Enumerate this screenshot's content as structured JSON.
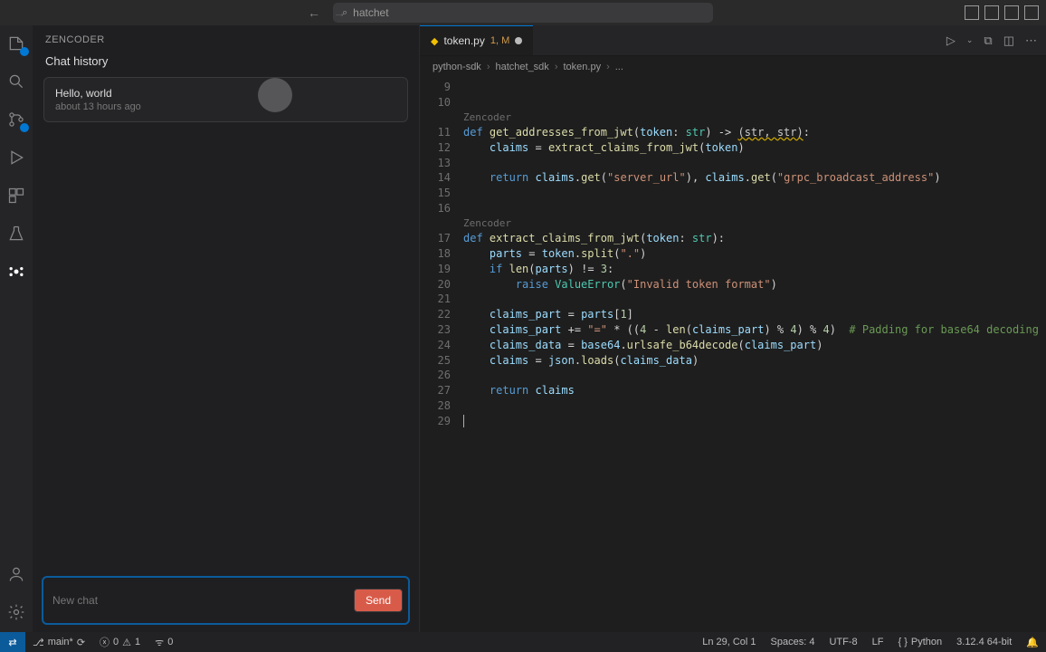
{
  "titlebar": {
    "search": "hatchet"
  },
  "sidebar": {
    "brand": "ZENCODER",
    "history_header": "Chat history",
    "items": [
      {
        "title": "Hello, world",
        "time": "about 13 hours ago"
      }
    ],
    "newchat_placeholder": "New chat",
    "send_label": "Send"
  },
  "tabs": {
    "file": "token.py",
    "problems": "1, M"
  },
  "breadcrumb": {
    "segments": [
      "python-sdk",
      "hatchet_sdk",
      "token.py",
      "..."
    ]
  },
  "codelens": "Zencoder",
  "code_lines": [
    {
      "n": 9,
      "seg": []
    },
    {
      "n": 10,
      "seg": []
    },
    {
      "lens": true
    },
    {
      "n": 11,
      "seg": [
        [
          "kw",
          "def "
        ],
        [
          "fn",
          "get_addresses_from_jwt"
        ],
        [
          "op",
          "("
        ],
        [
          "var",
          "token"
        ],
        [
          "op",
          ": "
        ],
        [
          "type",
          "str"
        ],
        [
          "op",
          ") -> "
        ],
        [
          "ret",
          "(str, str)"
        ],
        [
          "op",
          ":"
        ]
      ]
    },
    {
      "n": 12,
      "seg": [
        [
          "op",
          "    "
        ],
        [
          "var",
          "claims"
        ],
        [
          "op",
          " = "
        ],
        [
          "fn",
          "extract_claims_from_jwt"
        ],
        [
          "op",
          "("
        ],
        [
          "var",
          "token"
        ],
        [
          "op",
          ")"
        ]
      ]
    },
    {
      "n": 13,
      "seg": []
    },
    {
      "n": 14,
      "seg": [
        [
          "op",
          "    "
        ],
        [
          "kw",
          "return"
        ],
        [
          "op",
          " "
        ],
        [
          "var",
          "claims"
        ],
        [
          "op",
          "."
        ],
        [
          "fn",
          "get"
        ],
        [
          "op",
          "("
        ],
        [
          "str",
          "\"server_url\""
        ],
        [
          "op",
          "), "
        ],
        [
          "var",
          "claims"
        ],
        [
          "op",
          "."
        ],
        [
          "fn",
          "get"
        ],
        [
          "op",
          "("
        ],
        [
          "str",
          "\"grpc_broadcast_address\""
        ],
        [
          "op",
          ")"
        ]
      ]
    },
    {
      "n": 15,
      "seg": []
    },
    {
      "n": 16,
      "seg": []
    },
    {
      "lens": true
    },
    {
      "n": 17,
      "seg": [
        [
          "kw",
          "def "
        ],
        [
          "fn",
          "extract_claims_from_jwt"
        ],
        [
          "op",
          "("
        ],
        [
          "var",
          "token"
        ],
        [
          "op",
          ": "
        ],
        [
          "type",
          "str"
        ],
        [
          "op",
          "):"
        ]
      ]
    },
    {
      "n": 18,
      "seg": [
        [
          "op",
          "    "
        ],
        [
          "var",
          "parts"
        ],
        [
          "op",
          " = "
        ],
        [
          "var",
          "token"
        ],
        [
          "op",
          "."
        ],
        [
          "fn",
          "split"
        ],
        [
          "op",
          "("
        ],
        [
          "str",
          "\".\""
        ],
        [
          "op",
          ")"
        ]
      ]
    },
    {
      "n": 19,
      "seg": [
        [
          "op",
          "    "
        ],
        [
          "kw",
          "if"
        ],
        [
          "op",
          " "
        ],
        [
          "fn",
          "len"
        ],
        [
          "op",
          "("
        ],
        [
          "var",
          "parts"
        ],
        [
          "op",
          ") != "
        ],
        [
          "num",
          "3"
        ],
        [
          "op",
          ":"
        ]
      ]
    },
    {
      "n": 20,
      "seg": [
        [
          "op",
          "        "
        ],
        [
          "kw",
          "raise"
        ],
        [
          "op",
          " "
        ],
        [
          "type",
          "ValueError"
        ],
        [
          "op",
          "("
        ],
        [
          "str",
          "\"Invalid token format\""
        ],
        [
          "op",
          ")"
        ]
      ]
    },
    {
      "n": 21,
      "seg": []
    },
    {
      "n": 22,
      "seg": [
        [
          "op",
          "    "
        ],
        [
          "var",
          "claims_part"
        ],
        [
          "op",
          " = "
        ],
        [
          "var",
          "parts"
        ],
        [
          "op",
          "["
        ],
        [
          "num",
          "1"
        ],
        [
          "op",
          "]"
        ]
      ]
    },
    {
      "n": 23,
      "seg": [
        [
          "op",
          "    "
        ],
        [
          "var",
          "claims_part"
        ],
        [
          "op",
          " += "
        ],
        [
          "str",
          "\"=\""
        ],
        [
          "op",
          " * (("
        ],
        [
          "num",
          "4"
        ],
        [
          "op",
          " - "
        ],
        [
          "fn",
          "len"
        ],
        [
          "op",
          "("
        ],
        [
          "var",
          "claims_part"
        ],
        [
          "op",
          ") % "
        ],
        [
          "num",
          "4"
        ],
        [
          "op",
          ") % "
        ],
        [
          "num",
          "4"
        ],
        [
          "op",
          ")  "
        ],
        [
          "cmt",
          "# Padding for base64 decoding"
        ]
      ]
    },
    {
      "n": 24,
      "seg": [
        [
          "op",
          "    "
        ],
        [
          "var",
          "claims_data"
        ],
        [
          "op",
          " = "
        ],
        [
          "var",
          "base64"
        ],
        [
          "op",
          "."
        ],
        [
          "fn",
          "urlsafe_b64decode"
        ],
        [
          "op",
          "("
        ],
        [
          "var",
          "claims_part"
        ],
        [
          "op",
          ")"
        ]
      ]
    },
    {
      "n": 25,
      "seg": [
        [
          "op",
          "    "
        ],
        [
          "var",
          "claims"
        ],
        [
          "op",
          " = "
        ],
        [
          "var",
          "json"
        ],
        [
          "op",
          "."
        ],
        [
          "fn",
          "loads"
        ],
        [
          "op",
          "("
        ],
        [
          "var",
          "claims_data"
        ],
        [
          "op",
          ")"
        ]
      ]
    },
    {
      "n": 26,
      "seg": []
    },
    {
      "n": 27,
      "seg": [
        [
          "op",
          "    "
        ],
        [
          "kw",
          "return"
        ],
        [
          "op",
          " "
        ],
        [
          "var",
          "claims"
        ]
      ]
    },
    {
      "n": 28,
      "seg": []
    },
    {
      "n": 29,
      "seg": [],
      "cursor": true
    }
  ],
  "statusbar": {
    "branch": "main*",
    "sync": "⟳",
    "errors": "0",
    "warnings": "1",
    "ports": "0",
    "lncol": "Ln 29, Col 1",
    "spaces": "Spaces: 4",
    "encoding": "UTF-8",
    "eol": "LF",
    "lang": "Python",
    "interp": "3.12.4 64-bit"
  }
}
